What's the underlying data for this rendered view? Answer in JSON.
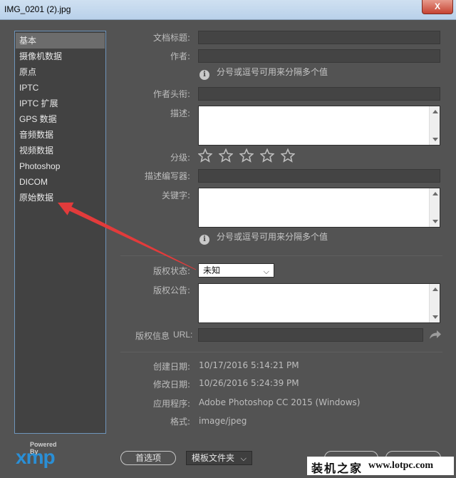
{
  "window": {
    "title": "IMG_0201 (2).jpg",
    "close_glyph": "X"
  },
  "sidebar": {
    "items": [
      {
        "label": "基本",
        "selected": true
      },
      {
        "label": "摄像机数据"
      },
      {
        "label": "原点"
      },
      {
        "label": "IPTC"
      },
      {
        "label": "IPTC 扩展"
      },
      {
        "label": "GPS 数据"
      },
      {
        "label": "音频数据"
      },
      {
        "label": "视频数据"
      },
      {
        "label": "Photoshop"
      },
      {
        "label": "DICOM"
      },
      {
        "label": "原始数据"
      }
    ]
  },
  "logo": {
    "powered_by": "Powered By",
    "brand": "xmp",
    "brand_color": "#2a8fd6"
  },
  "form": {
    "doc_title_label": "文档标题:",
    "author_label": "作者:",
    "author_hint": "分号或逗号可用来分隔多个值",
    "author_title_label": "作者头衔:",
    "description_label": "描述:",
    "rating_label": "分级:",
    "rating_stars": 0,
    "rating_max": 5,
    "desc_writer_label": "描述编写器:",
    "keywords_label": "关键字:",
    "keywords_hint": "分号或逗号可用来分隔多个值",
    "info_icon": "info-icon",
    "copyright_status_label": "版权状态:",
    "copyright_status_value": "未知",
    "copyright_notice_label": "版权公告:",
    "copyright_info_label": "版权信息",
    "url_label": "URL:"
  },
  "metadata": {
    "created_label": "创建日期:",
    "created_value": "10/17/2016 5:14:21 PM",
    "modified_label": "修改日期:",
    "modified_value": "10/26/2016 5:24:39 PM",
    "application_label": "应用程序:",
    "application_value": "Adobe Photoshop CC 2015 (Windows)",
    "format_label": "格式:",
    "format_value": "image/jpeg"
  },
  "footer": {
    "preferences_button": "首选项",
    "templates_button": "模板文件夹"
  },
  "watermark": {
    "site_cn": "装机之家",
    "site_url": "www.lotpc.com"
  },
  "annotation": {
    "arrow_color": "#e23b3b"
  }
}
